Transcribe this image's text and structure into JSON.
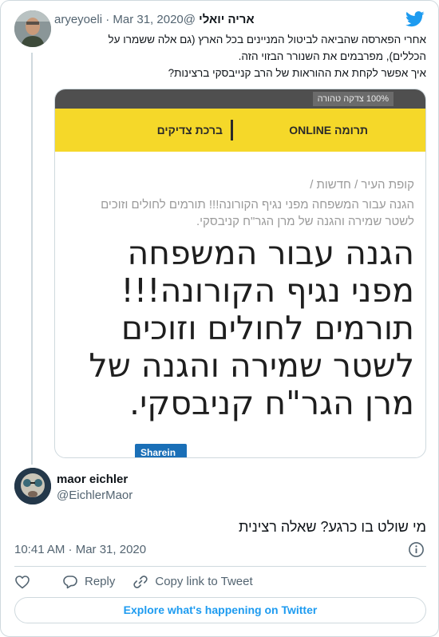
{
  "parent_tweet": {
    "author_name": "אריה יואלי",
    "author_handle": "@aryeyoeli",
    "separator": "·",
    "date": "Mar 31, 2020",
    "text_lines": [
      "אחרי הפארסה שהביאה לביטול המניינים בכל הארץ (גם אלה ששמרו על",
      "הכללים), מפרבמים את השנורר הבזוי הזה.",
      "איך אפשר לקחת את ההוראות של הרב קנייבסקי ברצינות?"
    ],
    "media": {
      "promo_text": "100% צדקה טהורה",
      "menu_right": "תרומה ONLINE",
      "menu_left": "ברכת צדיקים",
      "breadcrumb": "קופת העיר  /  חדשות  /",
      "subtitle_lines": [
        "הגנה עבור המשפחה מפני נגיף הקורונה!!! תורמים לחולים וזוכים",
        "לשטר שמירה והגנה של מרן הגר\"ח קניבסקי."
      ],
      "headline_lines": [
        "הגנה עבור המשפחה",
        "מפני נגיף הקורונה!!!",
        "תורמים לחולים וזוכים",
        "לשטר שמירה והגנה של",
        "מרן הגר\"ח קניבסקי."
      ],
      "share_label": "Share",
      "share_suffix": "in"
    }
  },
  "reply_tweet": {
    "author_name": "maor eichler",
    "author_handle": "@EichlerMaor",
    "text": "מי שולט בו כרגע? שאלה רצינית",
    "timestamp": "10:41 AM · Mar 31, 2020"
  },
  "actions": {
    "reply_label": "Reply",
    "copy_link_label": "Copy link to Tweet"
  },
  "explore_label": "Explore what's happening on Twitter",
  "colors": {
    "twitter_blue": "#1d9bf0",
    "yellow_bar": "#f5d829",
    "secondary_text": "#536471",
    "border": "#cfd9de"
  },
  "icons": [
    "twitter-bird-icon",
    "info-icon",
    "heart-icon",
    "reply-icon",
    "link-icon",
    "linkedin-icon"
  ]
}
